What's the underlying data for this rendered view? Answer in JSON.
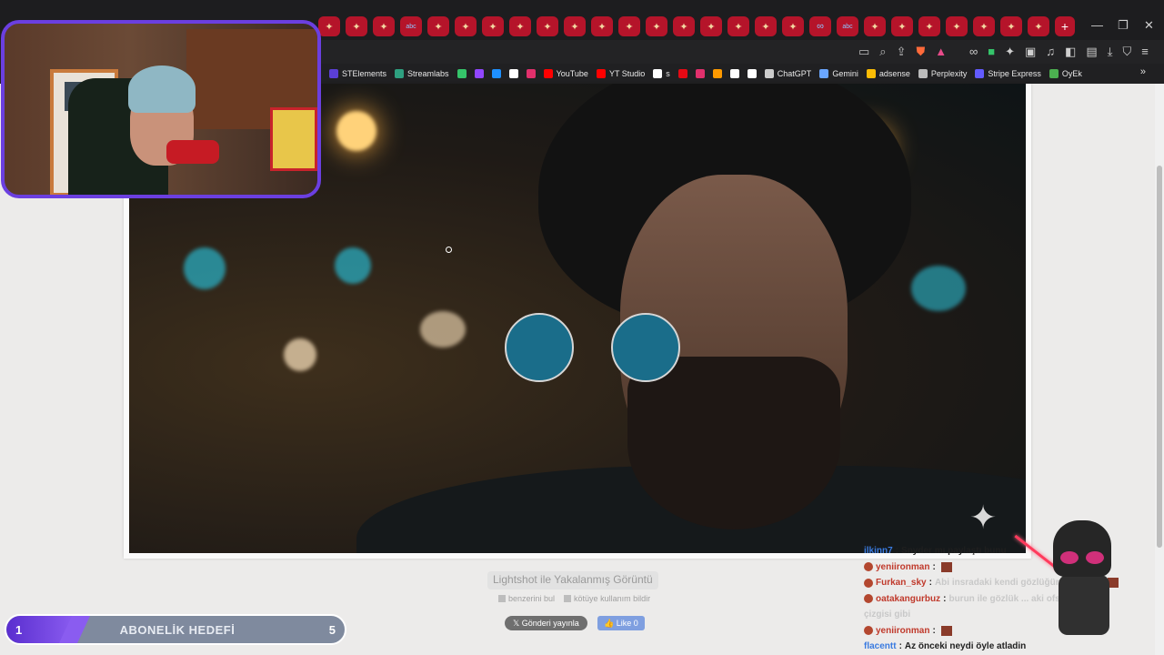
{
  "browser": {
    "bookmarks": [
      {
        "label": "STElements",
        "color": "#5b3fd6"
      },
      {
        "label": "Streamlabs",
        "color": "#2ea080"
      },
      {
        "label": "",
        "color": "#35c46a"
      },
      {
        "label": "",
        "color": "#9146ff"
      },
      {
        "label": "",
        "color": "#1e90ff"
      },
      {
        "label": "",
        "color": "#ffffff"
      },
      {
        "label": "",
        "color": "#e1306c"
      },
      {
        "label": "YouTube",
        "color": "#ff0000"
      },
      {
        "label": "YT Studio",
        "color": "#ff0000"
      },
      {
        "label": "s",
        "color": "#ffffff"
      },
      {
        "label": "",
        "color": "#e50914"
      },
      {
        "label": "",
        "color": "#e1306c"
      },
      {
        "label": "",
        "color": "#ff9a00"
      },
      {
        "label": "",
        "color": "#ffffff"
      },
      {
        "label": "",
        "color": "#ffffff"
      },
      {
        "label": "ChatGPT",
        "color": "#cccccc"
      },
      {
        "label": "Gemini",
        "color": "#6aa6ff"
      },
      {
        "label": "adsense",
        "color": "#fbbc05"
      },
      {
        "label": "Perplexity",
        "color": "#bbbbbb"
      },
      {
        "label": "Stripe Express",
        "color": "#635bff"
      },
      {
        "label": "OyEk",
        "color": "#4caf50"
      }
    ],
    "more_bookmarks": "»"
  },
  "page": {
    "caption": "Lightshot ile Yakalanmış Görüntü",
    "link_similar": "benzerini bul",
    "link_report": "kötüye kullanım bildir",
    "share_x": "𝕏  Gönderi yayınla",
    "share_fb": "👍 Like 0"
  },
  "goal": {
    "current": "1",
    "title": "ABONELİK HEDEFİ",
    "target": "5",
    "progress": 0.2
  },
  "chat": [
    {
      "user": "ilkinn7",
      "user_color": "#3a7be0",
      "sep": " : ",
      "msg": "Snyder mı paylaştı bunu",
      "light": false,
      "emote": false
    },
    {
      "user": "yeniironman",
      "user_color": "#c0392b",
      "sep": " : ",
      "msg": "",
      "light": false,
      "emote": true
    },
    {
      "user": "Furkan_sky",
      "user_color": "#c0392b",
      "sep": " : ",
      "msg": "Abi insradaki kendi gözlüğün ... aki den",
      "light": true,
      "emote": true
    },
    {
      "user": "oatakangurbuz",
      "user_color": "#c0392b",
      "sep": " : ",
      "msg": "burun ile gözlük ... aki ofsayt",
      "light": true,
      "emote": false
    },
    {
      "user": "",
      "user_color": "#c0392b",
      "sep": "",
      "msg": "çizgisi gibi",
      "light": true,
      "emote": false
    },
    {
      "user": "yeniironman",
      "user_color": "#c0392b",
      "sep": " : ",
      "msg": "",
      "light": false,
      "emote": true
    },
    {
      "user": "flacentt",
      "user_color": "#3a7be0",
      "sep": " : ",
      "msg": "Az önceki neydi öyle atladin",
      "light": false,
      "emote": false
    }
  ],
  "icons": {
    "tab": "red-ornament-tab-icon",
    "new_tab": "+",
    "minimize": "—",
    "maximize": "❐",
    "close": "✕"
  }
}
